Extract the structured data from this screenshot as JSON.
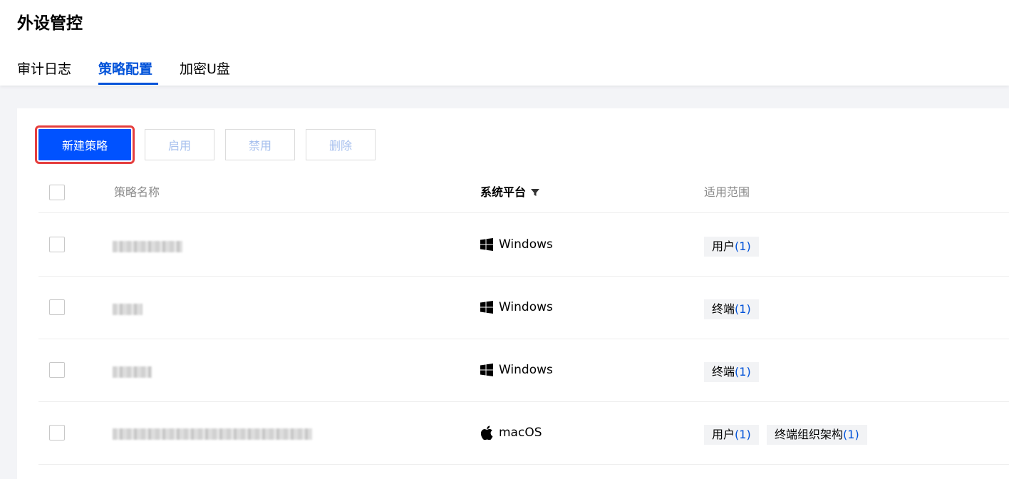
{
  "page": {
    "title": "外设管控"
  },
  "tabs": [
    {
      "label": "审计日志",
      "active": false
    },
    {
      "label": "策略配置",
      "active": true
    },
    {
      "label": "加密U盘",
      "active": false
    }
  ],
  "toolbar": {
    "new_label": "新建策略",
    "enable_label": "启用",
    "disable_label": "禁用",
    "delete_label": "删除"
  },
  "table": {
    "headers": {
      "name": "策略名称",
      "platform": "系统平台",
      "scope": "适用范围"
    },
    "rows": [
      {
        "name": "",
        "platform": "Windows",
        "platform_icon": "windows-icon",
        "tags": [
          {
            "label": "用户",
            "count": "(1)"
          }
        ]
      },
      {
        "name": "",
        "platform": "Windows",
        "platform_icon": "windows-icon",
        "tags": [
          {
            "label": "终端",
            "count": "(1)"
          }
        ]
      },
      {
        "name": "",
        "platform": "Windows",
        "platform_icon": "windows-icon",
        "tags": [
          {
            "label": "终端",
            "count": "(1)"
          }
        ]
      },
      {
        "name": "",
        "platform": "macOS",
        "platform_icon": "apple-icon",
        "tags": [
          {
            "label": "用户",
            "count": "(1)"
          },
          {
            "label": "终端组织架构",
            "count": "(1)"
          }
        ]
      }
    ]
  },
  "colors": {
    "accent": "#0052d9",
    "primary_button": "#0052ff",
    "highlight_outline": "#e53e3e"
  }
}
